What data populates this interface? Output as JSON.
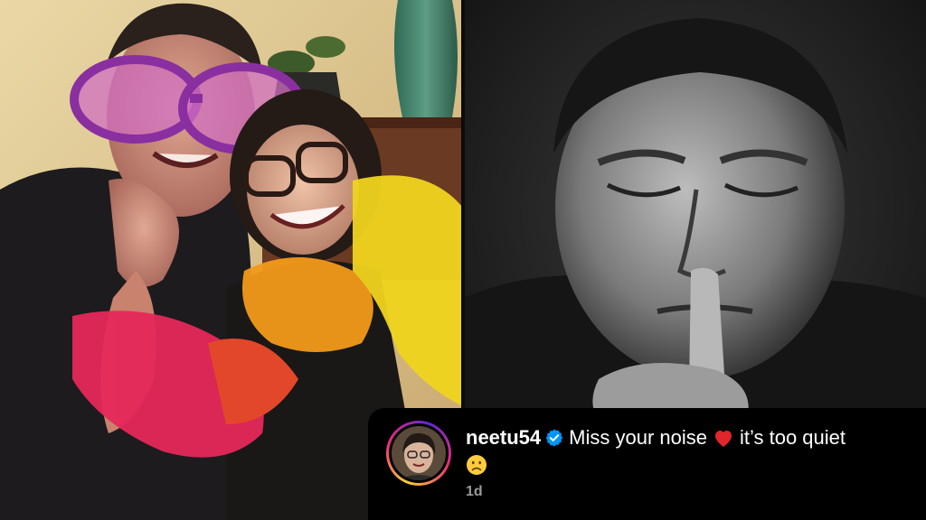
{
  "comment": {
    "username": "neetu54",
    "text_before": "Miss your noise",
    "text_after": "it’s too quiet",
    "timestamp": "1d"
  },
  "icons": {
    "verified": "verified-badge-icon",
    "heart": "red-heart-emoji",
    "frown": "slightly-frowning-face-emoji"
  },
  "colors": {
    "verified_blue": "#0095f6",
    "heart_red": "#e0262b",
    "background": "#000000"
  }
}
